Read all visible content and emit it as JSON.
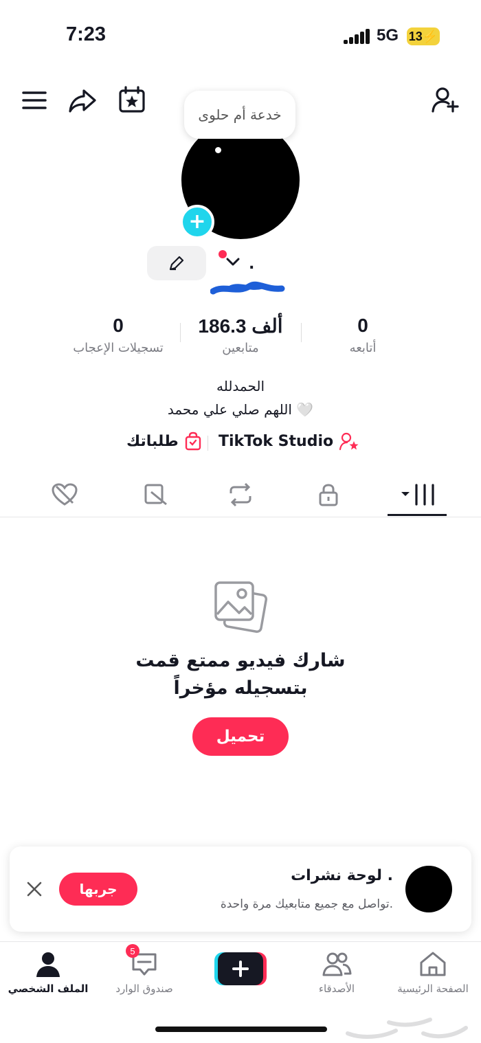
{
  "status_bar": {
    "time": "7:23",
    "network": "5G",
    "battery": "13"
  },
  "header": {
    "menu_icon": "hamburger-menu-icon",
    "share_icon": "share-icon",
    "calendar_icon": "calendar-star-icon",
    "add_friend_icon": "add-user-icon"
  },
  "profile": {
    "note_bubble": "خدعة أم حلوى",
    "name": ".",
    "stats": [
      {
        "value": "0",
        "label": "أتابعه"
      },
      {
        "value": "186.3 ألف",
        "label": "متابعين"
      },
      {
        "value": "0",
        "label": "تسجيلات الإعجاب"
      }
    ],
    "bio_line1": "الحمدلله",
    "bio_line2": "اللهم صلي علي محمد 🤍",
    "links": {
      "studio": "TikTok Studio",
      "orders": "طلباتك"
    }
  },
  "tabs": [
    "videos-grid",
    "private",
    "reposts",
    "tagged",
    "liked"
  ],
  "empty_state": {
    "title_line1": "شارك فيديو ممتع قمت",
    "title_line2": "بتسجيله مؤخراً",
    "upload_label": "تحميل"
  },
  "promo_card": {
    "title": "لوحة نشرات .",
    "subtitle": "تواصل مع جميع متابعيك مرة واحدة.",
    "try_label": "جربها"
  },
  "bottom_nav": {
    "home": "الصفحة الرئيسية",
    "friends": "الأصدقاء",
    "inbox": "صندوق الوارد",
    "inbox_badge": "5",
    "profile": "الملف الشخصي"
  },
  "colors": {
    "accent": "#fe2c55",
    "cyan": "#20d5ec",
    "text": "#161823"
  }
}
